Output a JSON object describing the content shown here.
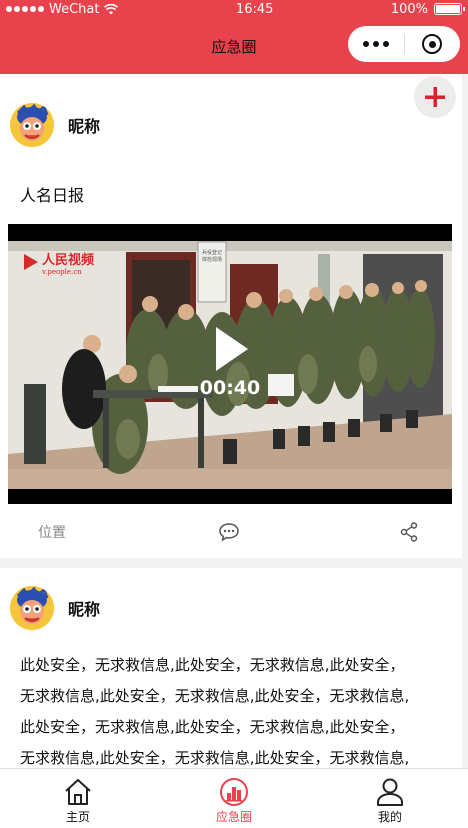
{
  "status_bar": {
    "carrier": "WeChat",
    "time": "16:45",
    "battery": "100%",
    "battery_level": 1.0
  },
  "nav": {
    "title": "应急圈"
  },
  "posts": [
    {
      "nickname": "昵称",
      "text": "人名日报",
      "video": {
        "duration": "00:40",
        "watermark_brand": "人民视频",
        "watermark_url": "v.people.cn",
        "sign_text": "兵役登记 体检现场"
      },
      "location_label": "位置"
    },
    {
      "nickname": "昵称",
      "lines": [
        "此处安全，无求救信息,此处安全，无求救信息,此处安全，",
        "无求救信息,此处安全，无求救信息,此处安全，无求救信息,",
        "此处安全，无求救信息,此处安全，无求救信息,此处安全，",
        "无求救信息,此处安全，无求救信息,此处安全，无求救信息,"
      ]
    }
  ],
  "tabbar": {
    "items": [
      {
        "label": "主页",
        "icon": "home-icon"
      },
      {
        "label": "应急圈",
        "icon": "emergency-circle-icon"
      },
      {
        "label": "我的",
        "icon": "person-icon"
      }
    ],
    "active_index": 1
  },
  "colors": {
    "brand": "#e8424c",
    "plus": "#d9232d"
  }
}
